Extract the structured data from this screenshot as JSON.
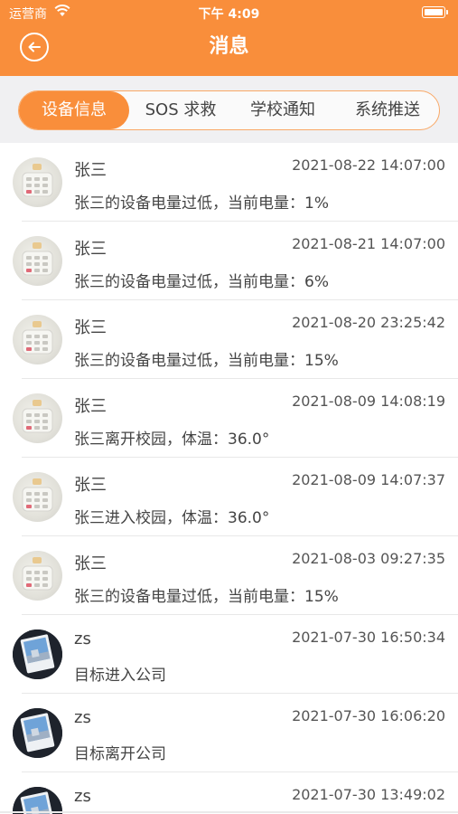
{
  "status_bar": {
    "carrier": "运营商",
    "time": "下午 4:09"
  },
  "header": {
    "title": "消息"
  },
  "tabs": [
    {
      "label": "设备信息",
      "active": true
    },
    {
      "label": "SOS 求救",
      "active": false
    },
    {
      "label": "学校通知",
      "active": false
    },
    {
      "label": "系统推送",
      "active": false
    }
  ],
  "messages": [
    {
      "name": "张三",
      "time": "2021-08-22 14:07:00",
      "text": "张三的设备电量过低，当前电量：1%",
      "avatar": "device-avatar"
    },
    {
      "name": "张三",
      "time": "2021-08-21 14:07:00",
      "text": "张三的设备电量过低，当前电量：6%",
      "avatar": "device-avatar"
    },
    {
      "name": "张三",
      "time": "2021-08-20 23:25:42",
      "text": "张三的设备电量过低，当前电量：15%",
      "avatar": "device-avatar"
    },
    {
      "name": "张三",
      "time": "2021-08-09 14:08:19",
      "text": "张三离开校园，体温：36.0°",
      "avatar": "device-avatar"
    },
    {
      "name": "张三",
      "time": "2021-08-09 14:07:37",
      "text": "张三进入校园，体温：36.0°",
      "avatar": "device-avatar"
    },
    {
      "name": "张三",
      "time": "2021-08-03 09:27:35",
      "text": "张三的设备电量过低，当前电量：15%",
      "avatar": "device-avatar"
    },
    {
      "name": "zs",
      "time": "2021-07-30 16:50:34",
      "text": "目标进入公司",
      "avatar": "photo-avatar"
    },
    {
      "name": "zs",
      "time": "2021-07-30 16:06:20",
      "text": "目标离开公司",
      "avatar": "photo-avatar"
    },
    {
      "name": "zs",
      "time": "2021-07-30 13:49:02",
      "text": "",
      "avatar": "photo-avatar"
    }
  ],
  "colors": {
    "accent": "#f98e3b",
    "background": "#f0f0f2"
  }
}
